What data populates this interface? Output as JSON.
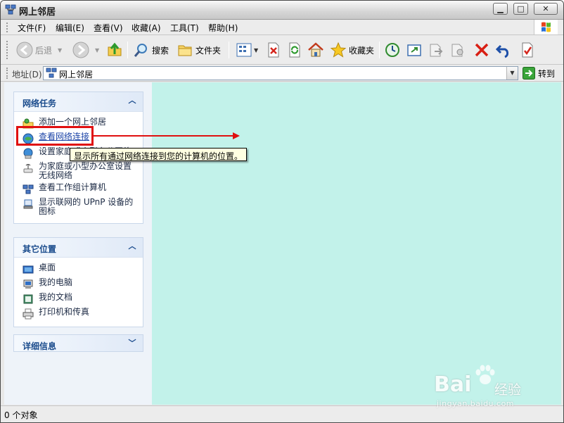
{
  "window": {
    "title": "网上邻居"
  },
  "menubar": {
    "items": [
      "文件(F)",
      "编辑(E)",
      "查看(V)",
      "收藏(A)",
      "工具(T)",
      "帮助(H)"
    ]
  },
  "toolbar": {
    "back_label": "后退",
    "search_label": "搜索",
    "folders_label": "文件夹",
    "favorites_label": "收藏夹"
  },
  "addressbar": {
    "label": "地址(D)",
    "value": "网上邻居",
    "go_label": "转到"
  },
  "panels": {
    "network_tasks": {
      "title": "网络任务",
      "items": [
        "添加一个网上邻居",
        "查看网络连接",
        "设置家庭或小型办公网络",
        "为家庭或小型办公室设置无线网络",
        "查看工作组计算机",
        "显示联网的 UPnP 设备的图标"
      ]
    },
    "other_places": {
      "title": "其它位置",
      "items": [
        "桌面",
        "我的电脑",
        "我的文档",
        "打印机和传真"
      ]
    },
    "details": {
      "title": "详细信息"
    }
  },
  "tooltip": {
    "text": "显示所有通过网络连接到您的计算机的位置。"
  },
  "statusbar": {
    "text": "0 个对象"
  },
  "watermark": {
    "brand": "Bai",
    "sub": "经验",
    "url": "jingyan.baidu.com"
  },
  "colors": {
    "content_bg": "#c2f2ea",
    "task_pane_bg": "#eef3f9",
    "panel_title": "#1a4b8c",
    "link": "#1d45a8",
    "annotation_red": "#e01010",
    "tooltip_bg": "#ffffe1"
  }
}
